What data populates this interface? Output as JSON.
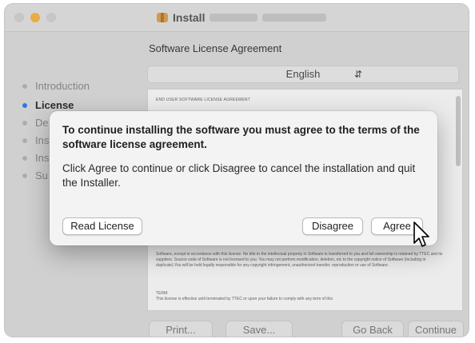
{
  "window": {
    "title": "Install"
  },
  "sidebar": {
    "items": [
      {
        "label": "Introduction",
        "state": "done"
      },
      {
        "label": "License",
        "state": "active"
      },
      {
        "label": "De",
        "state": "pending"
      },
      {
        "label": "Ins",
        "state": "pending"
      },
      {
        "label": "Ins",
        "state": "pending"
      },
      {
        "label": "Su",
        "state": "pending"
      }
    ]
  },
  "pane": {
    "title": "Software License Agreement",
    "language": "English",
    "license_heading": "END USER SOFTWARE LICENSE AGREEMENT",
    "license_body": "Software, except in accordance with this license. No title to the intellectual property in Software is transferred to you and full ownership is retained by TTEC and its suppliers. Source code of Software is not licensed to you. You may not perform modification, deletion, etc to the copyright notice of Software (including in duplicate).You will be held legally responsible for any copyright infringement, unauthorized transfer, reproduction or use of Software.",
    "term_label": "TERM:",
    "term_text": "This license is effective until terminated by TTEC or upon your failure to comply with any term of this"
  },
  "footer": {
    "print": "Print...",
    "save": "Save...",
    "go_back": "Go Back",
    "continue": "Continue"
  },
  "dialog": {
    "title": "To continue installing the software you must agree to the terms of the software license agreement.",
    "message": "Click Agree to continue or click Disagree to cancel the installation and quit the Installer.",
    "read_license": "Read License",
    "disagree": "Disagree",
    "agree": "Agree"
  },
  "colors": {
    "active_step": "#2f7bf5",
    "minimize_button": "#f4b34a"
  },
  "icons": [
    "package-icon",
    "chevron-updown-icon",
    "pointer-cursor-icon"
  ]
}
